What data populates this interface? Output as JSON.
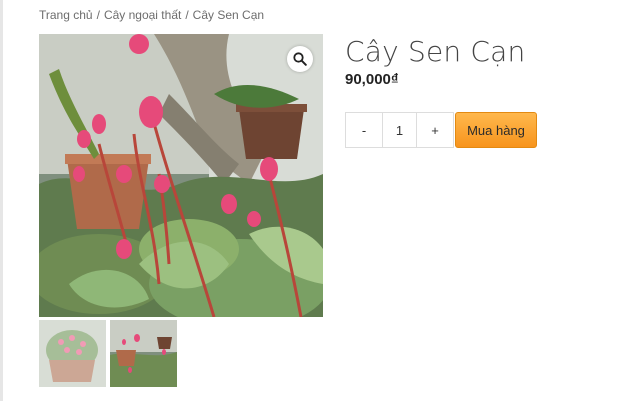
{
  "breadcrumb": {
    "home": "Trang chủ",
    "category": "Cây ngoại thất",
    "current": "Cây Sen Cạn",
    "separator": "/"
  },
  "product": {
    "title": "Cây Sen Cạn",
    "price": "90,000₫"
  },
  "quantity": {
    "minus": "-",
    "value": "1",
    "plus": "+"
  },
  "buy_label": "Mua hàng",
  "icons": {
    "zoom": "magnifier-icon"
  },
  "colors": {
    "buy_button": "#f7a435",
    "breadcrumb_text": "#6d6d6d"
  }
}
